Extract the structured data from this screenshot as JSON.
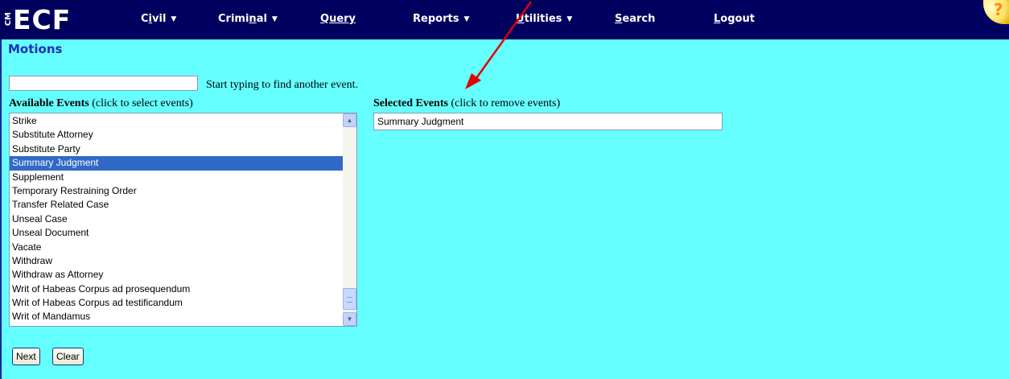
{
  "header": {
    "logo": {
      "cm": "CM",
      "ecf": "ECF"
    },
    "menu": [
      {
        "pre": "C",
        "u": "i",
        "post": "vil",
        "dropdown": true
      },
      {
        "pre": "Crimi",
        "u": "n",
        "post": "al",
        "dropdown": true
      },
      {
        "pre": "",
        "u": "Q",
        "post": "uery",
        "dropdown": false
      },
      {
        "pre": "Reports",
        "u": "",
        "post": "",
        "dropdown": true
      },
      {
        "pre": "",
        "u": "U",
        "post": "tilities",
        "dropdown": true
      },
      {
        "pre": "",
        "u": "S",
        "post": "earch",
        "dropdown": false
      },
      {
        "pre": "",
        "u": "L",
        "post": "ogout",
        "dropdown": false
      }
    ],
    "help_glyph": "?"
  },
  "page": {
    "title": "Motions"
  },
  "search": {
    "value": "",
    "hint": "Start typing to find another event."
  },
  "available": {
    "label_bold": "Available Events",
    "label_rest": " (click to select events)",
    "items": [
      "Strike",
      "Substitute Attorney",
      "Substitute Party",
      "Summary Judgment",
      "Supplement",
      "Temporary Restraining Order",
      "Transfer Related Case",
      "Unseal Case",
      "Unseal Document",
      "Vacate",
      "Withdraw",
      "Withdraw as Attorney",
      "Writ of Habeas Corpus ad prosequendum",
      "Writ of Habeas Corpus ad testificandum",
      "Writ of Mandamus"
    ],
    "selected_item": "Summary Judgment"
  },
  "selected": {
    "label_bold": "Selected Events",
    "label_rest": " (click to remove events)",
    "items": [
      "Summary Judgment"
    ]
  },
  "buttons": {
    "next": "Next",
    "clear": "Clear"
  },
  "annotation": {
    "color": "#e00000"
  }
}
